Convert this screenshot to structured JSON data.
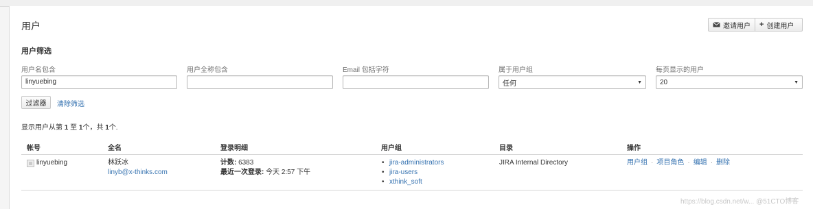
{
  "header": {
    "title": "用户",
    "invite_label": "邀请用户",
    "create_label": "创建用户"
  },
  "filter": {
    "title": "用户筛选",
    "username_label": "用户名包含",
    "username_value": "linyuebing",
    "fullname_label": "用户全称包含",
    "fullname_value": "",
    "email_label": "Email 包括字符",
    "email_value": "",
    "group_label": "属于用户组",
    "group_value": "任何",
    "perpage_label": "每页显示的用户",
    "perpage_value": "20",
    "filter_button": "过滤器",
    "clear_link": "清除筛选"
  },
  "summary": {
    "prefix": "显示用户从第 ",
    "from": "1",
    "mid": " 至 ",
    "to": "1",
    "mid2": "个，共 ",
    "total": "1",
    "suffix": "个."
  },
  "table": {
    "headers": [
      "帐号",
      "全名",
      "登录明细",
      "用户组",
      "目录",
      "操作"
    ],
    "rows": [
      {
        "username": "linyuebing",
        "fullname": "林跃冰",
        "email": "linyb@x-thinks.com",
        "login_count_label": "计数:",
        "login_count": "6383",
        "last_login_label": "最近一次登录:",
        "last_login": "今天 2:57 下午",
        "groups": [
          "jira-administrators",
          "jira-users",
          "xthink_soft"
        ],
        "directory": "JIRA Internal Directory",
        "ops": [
          "用户组",
          "项目角色",
          "编辑",
          "删除"
        ]
      }
    ]
  },
  "watermark": "https://blog.csdn.net/w... @51CTO博客"
}
